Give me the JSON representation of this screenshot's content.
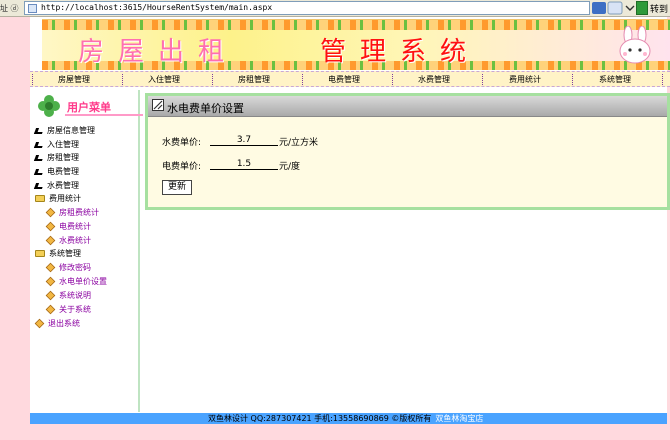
{
  "browser": {
    "address_label": "址 ⓓ",
    "url": "http://localhost:3615/HourseRentSystem/main.aspx",
    "go_label": "转到"
  },
  "banner": {
    "title_left": "房屋出租",
    "title_right": "管理系统"
  },
  "nav": {
    "items": [
      "房屋管理",
      "入住管理",
      "房租管理",
      "电费管理",
      "水费管理",
      "费用统计",
      "系统管理"
    ]
  },
  "sidebar": {
    "title": "用户菜单",
    "items": [
      {
        "label": "房屋信息管理",
        "icon": "arrow-icon",
        "level": 0
      },
      {
        "label": "入住管理",
        "icon": "arrow-icon",
        "level": 0
      },
      {
        "label": "房租管理",
        "icon": "arrow-icon",
        "level": 0
      },
      {
        "label": "电费管理",
        "icon": "arrow-icon",
        "level": 0
      },
      {
        "label": "水费管理",
        "icon": "arrow-icon",
        "level": 0
      },
      {
        "label": "费用统计",
        "icon": "folder-icon",
        "level": 0
      },
      {
        "label": "房租费统计",
        "icon": "leaf-icon",
        "level": 1
      },
      {
        "label": "电费统计",
        "icon": "leaf-icon",
        "level": 1
      },
      {
        "label": "水费统计",
        "icon": "leaf-icon",
        "level": 1
      },
      {
        "label": "系统管理",
        "icon": "folder-icon",
        "level": 0
      },
      {
        "label": "修改密码",
        "icon": "leaf-icon",
        "level": 1
      },
      {
        "label": "水电单价设置",
        "icon": "leaf-icon",
        "level": 1
      },
      {
        "label": "系统说明",
        "icon": "leaf-icon",
        "level": 1
      },
      {
        "label": "关于系统",
        "icon": "leaf-icon",
        "level": 1
      },
      {
        "label": "退出系统",
        "icon": "leaf-icon",
        "level": 0
      }
    ]
  },
  "content": {
    "title": "水电费单价设置",
    "water": {
      "label": "水费单价:",
      "value": "3.7",
      "unit": "元/立方米"
    },
    "electric": {
      "label": "电费单价:",
      "value": "1.5",
      "unit": "元/度"
    },
    "update_label": "更新"
  },
  "footer": {
    "text": "双鱼林设计 QQ:287307421 手机:13558690869 ©版权所有",
    "link": "双鱼林淘宝店"
  },
  "colors": {
    "pink_margin": "#ffd9de",
    "content_border": "#a6e0a0",
    "footer_bar": "#4aa3ff",
    "submenu_text": "#8a00a0"
  }
}
